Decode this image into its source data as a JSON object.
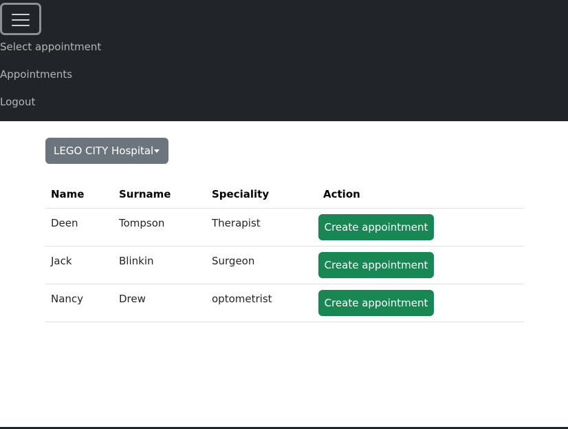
{
  "navbar": {
    "toggler_icon": "hamburger-menu-icon",
    "links": [
      {
        "label": "Select appointment"
      },
      {
        "label": "Appointments"
      },
      {
        "label": "Logout"
      }
    ]
  },
  "hospital_dropdown": {
    "selected": "LEGO CITY Hospital",
    "icon": "caret-down-icon"
  },
  "doctors_table": {
    "headers": [
      "Name",
      "Surname",
      "Speciality",
      "Action"
    ],
    "rows": [
      {
        "name": "Deen",
        "surname": "Tompson",
        "speciality": "Therapist",
        "action": "Create appointment"
      },
      {
        "name": "Jack",
        "surname": "Blinkin",
        "speciality": "Surgeon",
        "action": "Create appointment"
      },
      {
        "name": "Nancy",
        "surname": "Drew",
        "speciality": "optometrist",
        "action": "Create appointment"
      }
    ]
  },
  "colors": {
    "navbar_bg": "#212529",
    "dropdown_bg": "#6c757d",
    "button_green": "#198754"
  }
}
